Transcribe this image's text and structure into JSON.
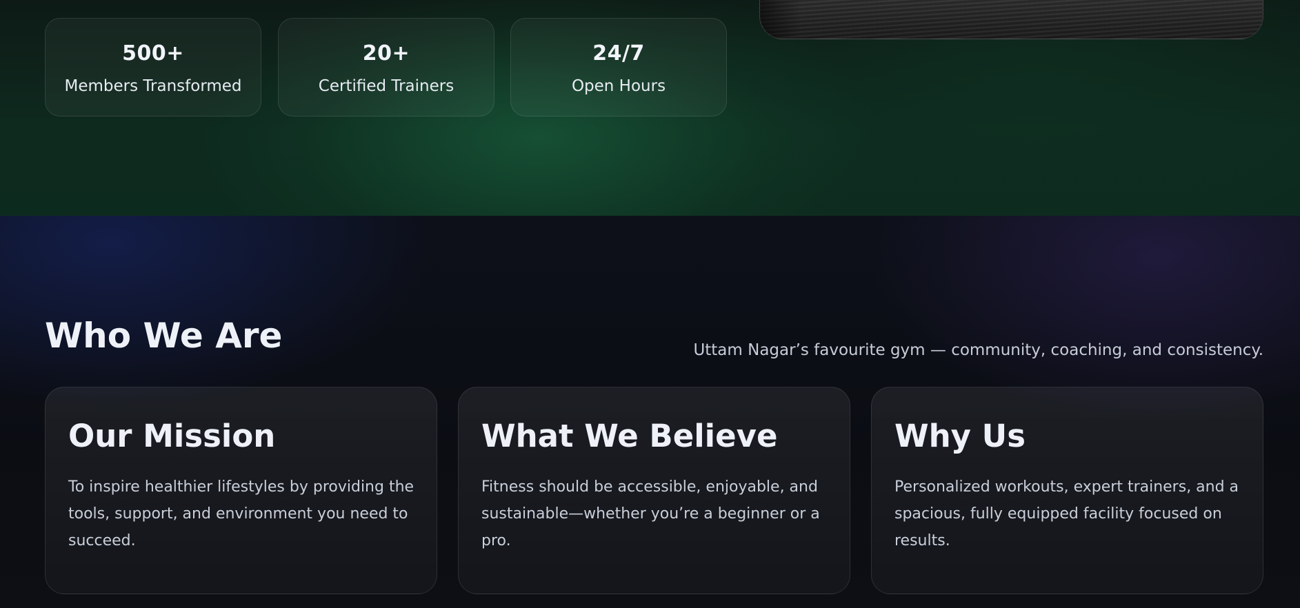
{
  "hero": {
    "image_alt": "gym floor photo",
    "stats": [
      {
        "value": "500+",
        "label": "Members Transformed"
      },
      {
        "value": "20+",
        "label": "Certified Trainers"
      },
      {
        "value": "24/7",
        "label": "Open Hours"
      }
    ]
  },
  "about": {
    "title": "Who We Are",
    "tagline": "Uttam Nagar’s favourite gym — community, coaching, and consistency.",
    "cards": [
      {
        "title": "Our Mission",
        "text": "To inspire healthier lifestyles by providing the tools, support, and environment you need to succeed."
      },
      {
        "title": "What We Believe",
        "text": "Fitness should be accessible, enjoyable, and sustainable—whether you’re a beginner or a pro."
      },
      {
        "title": "Why Us",
        "text": "Personalized workouts, expert trainers, and a spacious, fully equipped facility focused on results."
      }
    ]
  },
  "colors": {
    "hero_green": "#1c6e44",
    "about_blue": "#18286e",
    "about_purple": "#2e2256",
    "text_primary": "#eef2f8",
    "text_muted": "#c9cfda"
  }
}
